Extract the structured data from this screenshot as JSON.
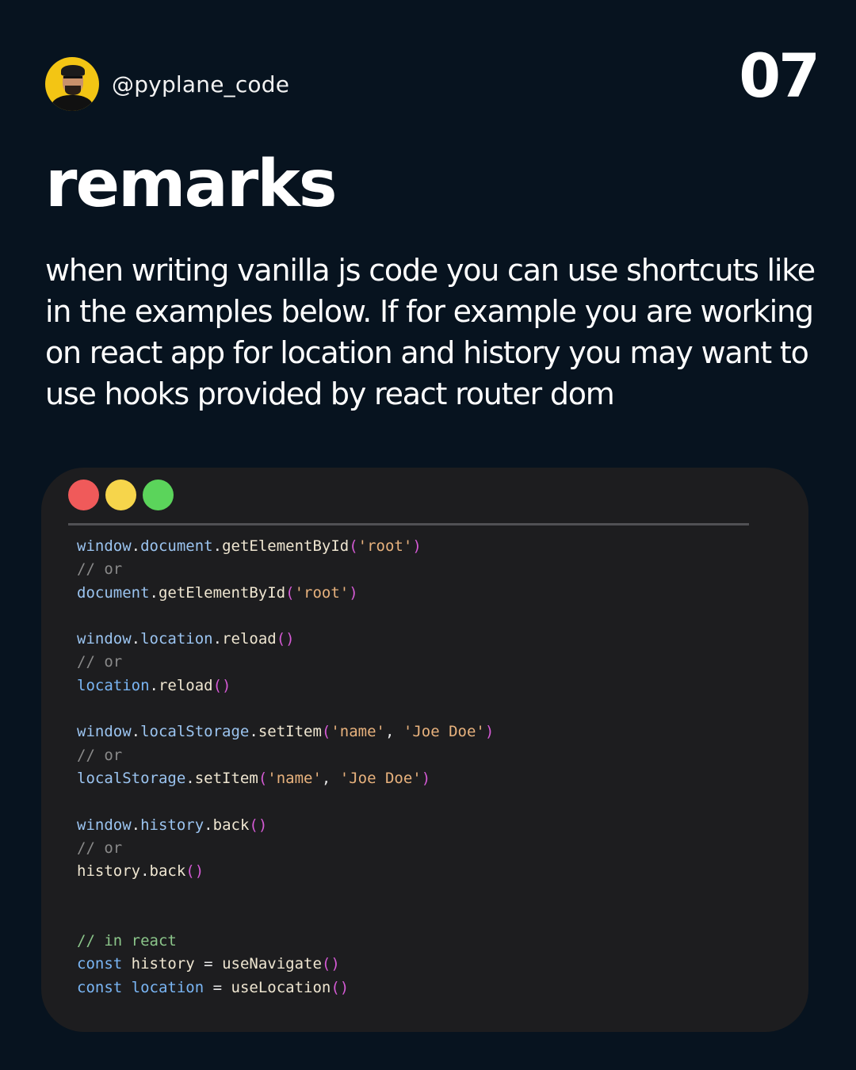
{
  "header": {
    "handle": "@pyplane_code",
    "page_number": "07"
  },
  "content": {
    "title": "remarks",
    "description": "when writing vanilla js code you can use shortcuts like in the examples below. If for example you are working on react app for location and history you may want to use hooks provided by react router dom"
  },
  "code_window": {
    "buttons": [
      "close-dot",
      "minimize-dot",
      "zoom-dot"
    ],
    "colors": {
      "close": "#f05a5a",
      "minimize": "#f6d54b",
      "zoom": "#5bd45b",
      "background": "#1d1d1f"
    },
    "lines": [
      [
        {
          "t": "window",
          "c": "obj"
        },
        {
          "t": ".",
          "c": "plain"
        },
        {
          "t": "document",
          "c": "obj"
        },
        {
          "t": ".",
          "c": "plain"
        },
        {
          "t": "getElementById",
          "c": "fn"
        },
        {
          "t": "(",
          "c": "paren"
        },
        {
          "t": "'root'",
          "c": "str"
        },
        {
          "t": ")",
          "c": "paren"
        }
      ],
      [
        {
          "t": "// or",
          "c": "comment"
        }
      ],
      [
        {
          "t": "document",
          "c": "obj"
        },
        {
          "t": ".",
          "c": "plain"
        },
        {
          "t": "getElementById",
          "c": "fn"
        },
        {
          "t": "(",
          "c": "paren"
        },
        {
          "t": "'root'",
          "c": "str"
        },
        {
          "t": ")",
          "c": "paren"
        }
      ],
      [],
      [
        {
          "t": "window",
          "c": "obj"
        },
        {
          "t": ".",
          "c": "plain"
        },
        {
          "t": "location",
          "c": "obj"
        },
        {
          "t": ".",
          "c": "plain"
        },
        {
          "t": "reload",
          "c": "fn"
        },
        {
          "t": "()",
          "c": "paren"
        }
      ],
      [
        {
          "t": "// or",
          "c": "comment"
        }
      ],
      [
        {
          "t": "location",
          "c": "var"
        },
        {
          "t": ".",
          "c": "plain"
        },
        {
          "t": "reload",
          "c": "fn"
        },
        {
          "t": "()",
          "c": "paren"
        }
      ],
      [],
      [
        {
          "t": "window",
          "c": "obj"
        },
        {
          "t": ".",
          "c": "plain"
        },
        {
          "t": "localStorage",
          "c": "obj"
        },
        {
          "t": ".",
          "c": "plain"
        },
        {
          "t": "setItem",
          "c": "fn"
        },
        {
          "t": "(",
          "c": "paren"
        },
        {
          "t": "'name'",
          "c": "str"
        },
        {
          "t": ", ",
          "c": "plain"
        },
        {
          "t": "'Joe Doe'",
          "c": "str"
        },
        {
          "t": ")",
          "c": "paren"
        }
      ],
      [
        {
          "t": "// or",
          "c": "comment"
        }
      ],
      [
        {
          "t": "localStorage",
          "c": "obj"
        },
        {
          "t": ".",
          "c": "plain"
        },
        {
          "t": "setItem",
          "c": "fn"
        },
        {
          "t": "(",
          "c": "paren"
        },
        {
          "t": "'name'",
          "c": "str"
        },
        {
          "t": ", ",
          "c": "plain"
        },
        {
          "t": "'Joe Doe'",
          "c": "str"
        },
        {
          "t": ")",
          "c": "paren"
        }
      ],
      [],
      [
        {
          "t": "window",
          "c": "obj"
        },
        {
          "t": ".",
          "c": "plain"
        },
        {
          "t": "history",
          "c": "obj"
        },
        {
          "t": ".",
          "c": "plain"
        },
        {
          "t": "back",
          "c": "fn"
        },
        {
          "t": "()",
          "c": "paren"
        }
      ],
      [
        {
          "t": "// or",
          "c": "comment"
        }
      ],
      [
        {
          "t": "history",
          "c": "fn"
        },
        {
          "t": ".",
          "c": "plain"
        },
        {
          "t": "back",
          "c": "fn"
        },
        {
          "t": "()",
          "c": "paren"
        }
      ],
      [],
      [],
      [
        {
          "t": "// in react",
          "c": "green"
        }
      ],
      [
        {
          "t": "const",
          "c": "kw"
        },
        {
          "t": " ",
          "c": "plain"
        },
        {
          "t": "history",
          "c": "fn"
        },
        {
          "t": " = ",
          "c": "plain"
        },
        {
          "t": "useNavigate",
          "c": "fn"
        },
        {
          "t": "()",
          "c": "paren"
        }
      ],
      [
        {
          "t": "const",
          "c": "kw"
        },
        {
          "t": " ",
          "c": "plain"
        },
        {
          "t": "location",
          "c": "var"
        },
        {
          "t": " = ",
          "c": "plain"
        },
        {
          "t": "useLocation",
          "c": "fn"
        },
        {
          "t": "()",
          "c": "paren"
        }
      ]
    ]
  }
}
